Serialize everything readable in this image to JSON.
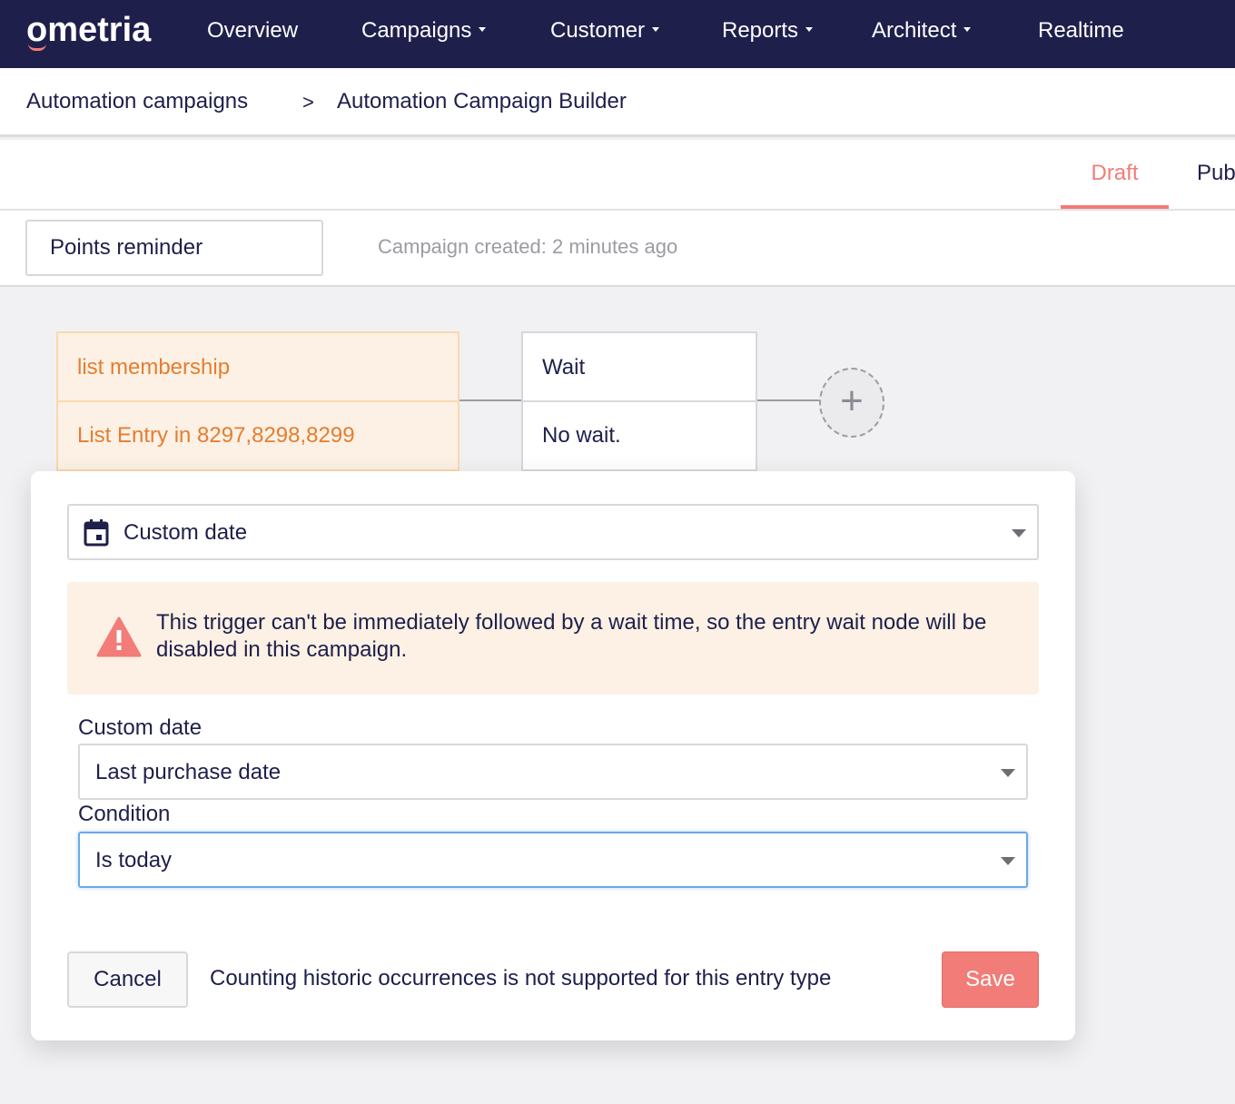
{
  "nav": {
    "logo": "ometria",
    "items": [
      {
        "label": "Overview",
        "dropdown": false
      },
      {
        "label": "Campaigns",
        "dropdown": true
      },
      {
        "label": "Customer",
        "dropdown": true
      },
      {
        "label": "Reports",
        "dropdown": true
      },
      {
        "label": "Architect",
        "dropdown": true
      },
      {
        "label": "Realtime",
        "dropdown": false
      }
    ]
  },
  "breadcrumb": {
    "parent": "Automation campaigns",
    "separator": ">",
    "current": "Automation Campaign Builder"
  },
  "tabs": {
    "draft": "Draft",
    "publish": "Pub"
  },
  "campaign": {
    "name": "Points reminder",
    "created": "Campaign created: 2 minutes ago"
  },
  "nodes": {
    "trigger": {
      "title": "list membership",
      "detail": "List Entry in 8297,8298,8299"
    },
    "wait": {
      "title": "Wait",
      "detail": "No wait."
    },
    "add_symbol": "+"
  },
  "modal": {
    "trigger_type": {
      "value": "Custom date",
      "icon": "calendar-icon"
    },
    "warning": {
      "icon": "warning-icon",
      "text": "This trigger can't be immediately followed by a wait time, so the entry wait node will be disabled in this campaign."
    },
    "custom_date": {
      "label": "Custom date",
      "value": "Last purchase date"
    },
    "condition": {
      "label": "Condition",
      "value": "Is today"
    },
    "cancel_label": "Cancel",
    "note": "Counting historic occurrences is not supported for this entry type",
    "save_label": "Save"
  },
  "colors": {
    "nav_bg": "#1e1f4b",
    "accent": "#f27c77",
    "trigger_bg": "#fcf1e4",
    "trigger_text": "#e57d31",
    "focus": "#6aa9e6"
  }
}
